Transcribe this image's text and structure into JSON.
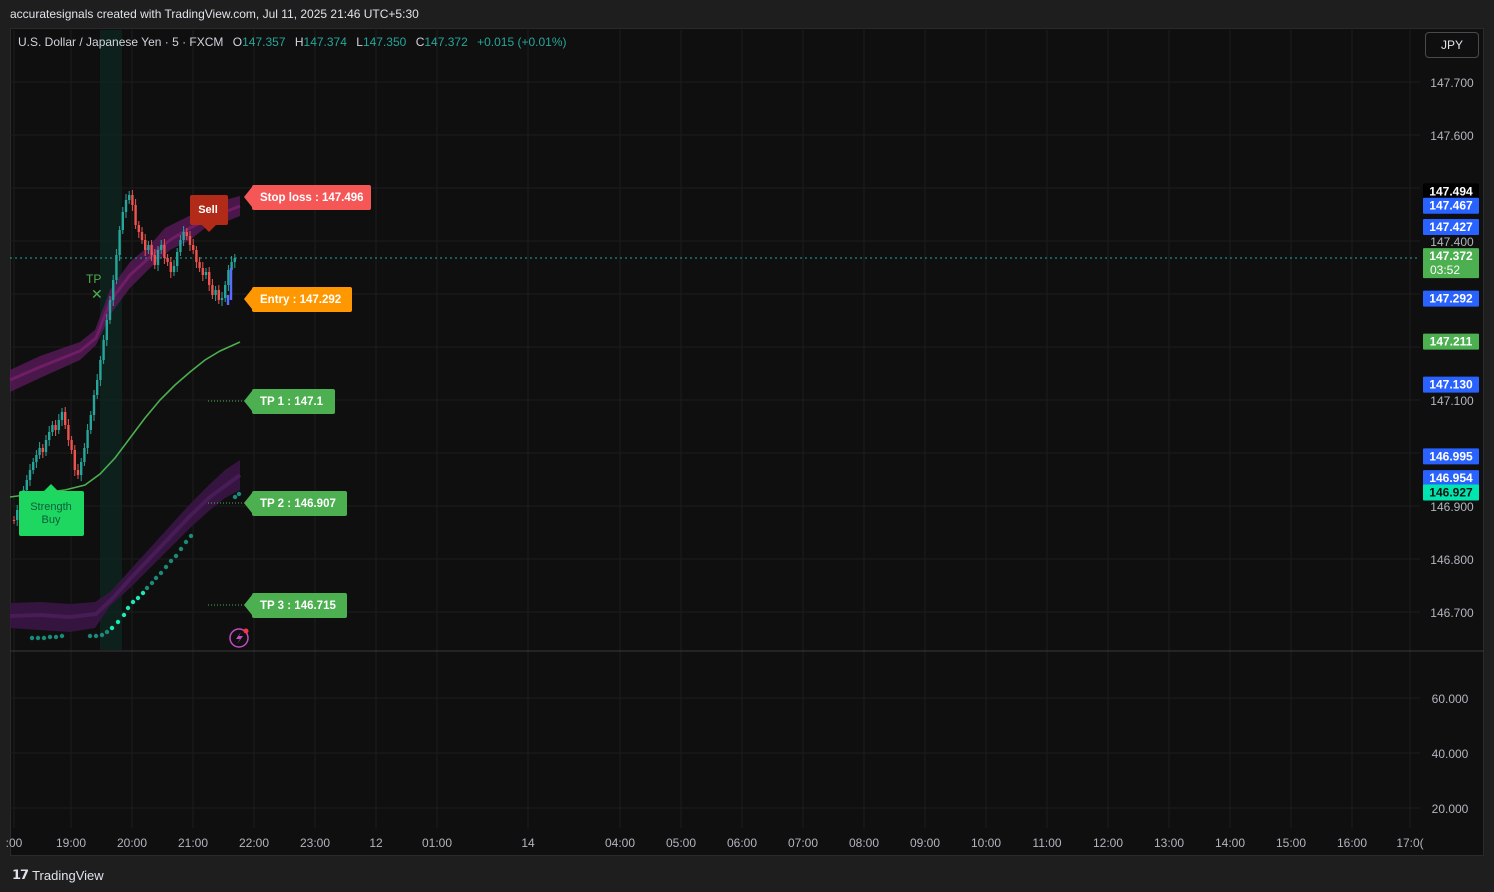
{
  "header": {
    "title": "accuratesignals created with TradingView.com, Jul 11, 2025 21:46 UTC+5:30"
  },
  "legend": {
    "symbol": "U.S. Dollar / Japanese Yen · 5 · FXCM",
    "open_key": "O",
    "open": "147.357",
    "high_key": "H",
    "high": "147.374",
    "low_key": "L",
    "low": "147.350",
    "close_key": "C",
    "close": "147.372",
    "change": "+0.015 (+0.01%)"
  },
  "currency_button": "JPY",
  "price_axis": {
    "ticks": [
      "147.700",
      "147.600",
      "147.400",
      "147.100",
      "146.900",
      "146.800",
      "146.700"
    ]
  },
  "indicator_axis": {
    "ticks": [
      "60.000",
      "40.000",
      "20.000"
    ]
  },
  "price_badges": [
    {
      "label": "147.494",
      "color": "#000000",
      "text_color": "#ffffff"
    },
    {
      "label": "147.467",
      "color": "#2962ff",
      "text_color": "#ffffff"
    },
    {
      "label": "147.427",
      "color": "#2962ff",
      "text_color": "#ffffff"
    },
    {
      "label": "147.372",
      "sub": "03:52",
      "color": "#4caf50",
      "text_color": "#ffffff"
    },
    {
      "label": "147.292",
      "color": "#2962ff",
      "text_color": "#ffffff"
    },
    {
      "label": "147.211",
      "color": "#4caf50",
      "text_color": "#ffffff"
    },
    {
      "label": "147.130",
      "color": "#2962ff",
      "text_color": "#ffffff"
    },
    {
      "label": "146.995",
      "color": "#2962ff",
      "text_color": "#ffffff"
    },
    {
      "label": "146.954",
      "color": "#2962ff",
      "text_color": "#ffffff"
    },
    {
      "label": "146.927",
      "color": "#00e5b0",
      "text_color": "#0f0f0f"
    }
  ],
  "time_axis": {
    "ticks": [
      ":00",
      "19:00",
      "20:00",
      "21:00",
      "22:00",
      "23:00",
      "12",
      "01:00",
      "14",
      "04:00",
      "05:00",
      "06:00",
      "07:00",
      "08:00",
      "09:00",
      "10:00",
      "11:00",
      "12:00",
      "13:00",
      "14:00",
      "15:00",
      "16:00",
      "17:0("
    ]
  },
  "signals": {
    "sell": "Sell",
    "stop_loss": "Stop loss : 147.496",
    "entry": "Entry : 147.292",
    "tp1": "TP 1 : 147.1",
    "tp2": "TP 2 : 146.907",
    "tp3": "TP 3 : 146.715",
    "strength_buy_line1": "Strength",
    "strength_buy_line2": "Buy",
    "tp_marker": "TP"
  },
  "footer": {
    "brand": "TradingView"
  },
  "colors": {
    "up": "#26a69a",
    "down": "#ef5350",
    "green_label": "#4caf50",
    "stop_label": "#f23645",
    "entry_label": "#ff9800",
    "sell_label": "#b22a18",
    "band": "#6a1b9a"
  }
}
